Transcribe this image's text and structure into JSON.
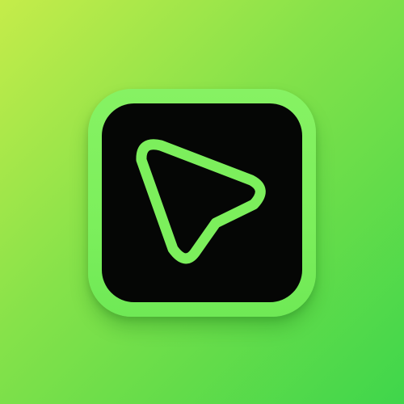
{
  "icon": {
    "name": "navigation-pointer-icon",
    "accent_color": "#7cef5c",
    "inner_color": "#050605"
  }
}
